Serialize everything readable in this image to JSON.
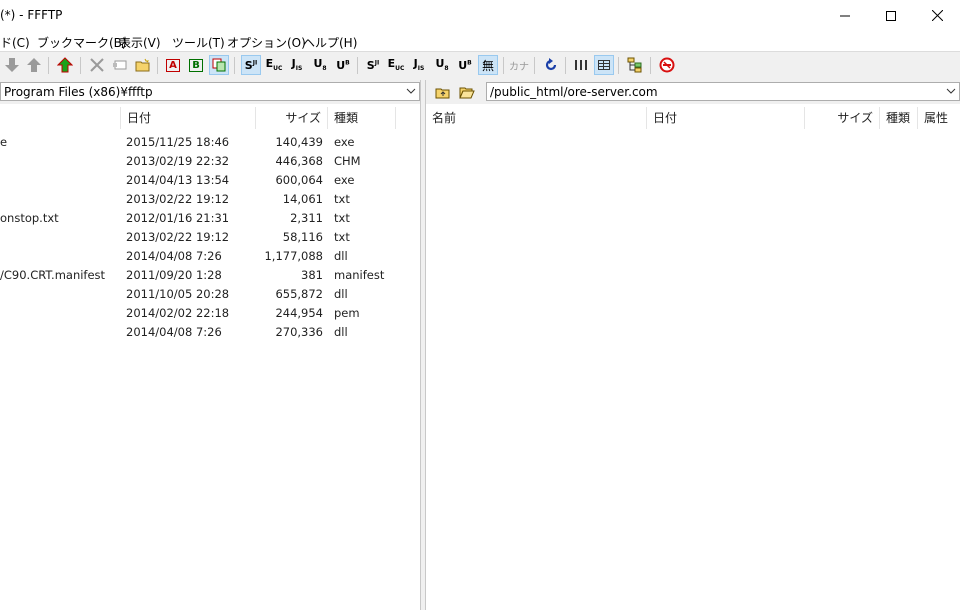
{
  "window": {
    "title": "(*) - FFFTP"
  },
  "menu": [
    "ド(C)",
    "ブックマーク(B)",
    "表示(V)",
    "ツール(T)",
    "オプション(O)",
    "ヘルプ(H)"
  ],
  "toolbar": {
    "txt_a": "A",
    "txt_b": "B",
    "kana": "カナ",
    "mu": "無",
    "sjis_s": "S",
    "sjis_sub": "JI",
    "euc_e": "E",
    "euc_sub": "UC",
    "jis_j": "J",
    "jis_sub": "IS",
    "utf_u": "U",
    "utf8_sub": "8",
    "utfbom_sub": "B"
  },
  "local": {
    "path": "Program Files (x86)¥ffftp",
    "columns": {
      "name": "",
      "date": "日付",
      "size": "サイズ",
      "type": "種類"
    },
    "files": [
      {
        "name": "e",
        "date": "2015/11/25 18:46",
        "size": "140,439",
        "type": "exe"
      },
      {
        "name": "",
        "date": "2013/02/19 22:32",
        "size": "446,368",
        "type": "CHM"
      },
      {
        "name": "",
        "date": "2014/04/13 13:54",
        "size": "600,064",
        "type": "exe"
      },
      {
        "name": "",
        "date": "2013/02/22 19:12",
        "size": "14,061",
        "type": "txt"
      },
      {
        "name": "onstop.txt",
        "date": "2012/01/16 21:31",
        "size": "2,311",
        "type": "txt"
      },
      {
        "name": "",
        "date": "2013/02/22 19:12",
        "size": "58,116",
        "type": "txt"
      },
      {
        "name": "",
        "date": "2014/04/08 7:26",
        "size": "1,177,088",
        "type": "dll"
      },
      {
        "name": "/C90.CRT.manifest",
        "date": "2011/09/20 1:28",
        "size": "381",
        "type": "manifest"
      },
      {
        "name": "",
        "date": "2011/10/05 20:28",
        "size": "655,872",
        "type": "dll"
      },
      {
        "name": "",
        "date": "2014/02/02 22:18",
        "size": "244,954",
        "type": "pem"
      },
      {
        "name": "",
        "date": "2014/04/08 7:26",
        "size": "270,336",
        "type": "dll"
      }
    ]
  },
  "remote": {
    "path": "/public_html/ore-server.com",
    "columns": {
      "name": "名前",
      "date": "日付",
      "size": "サイズ",
      "type": "種類",
      "attr": "属性"
    }
  }
}
